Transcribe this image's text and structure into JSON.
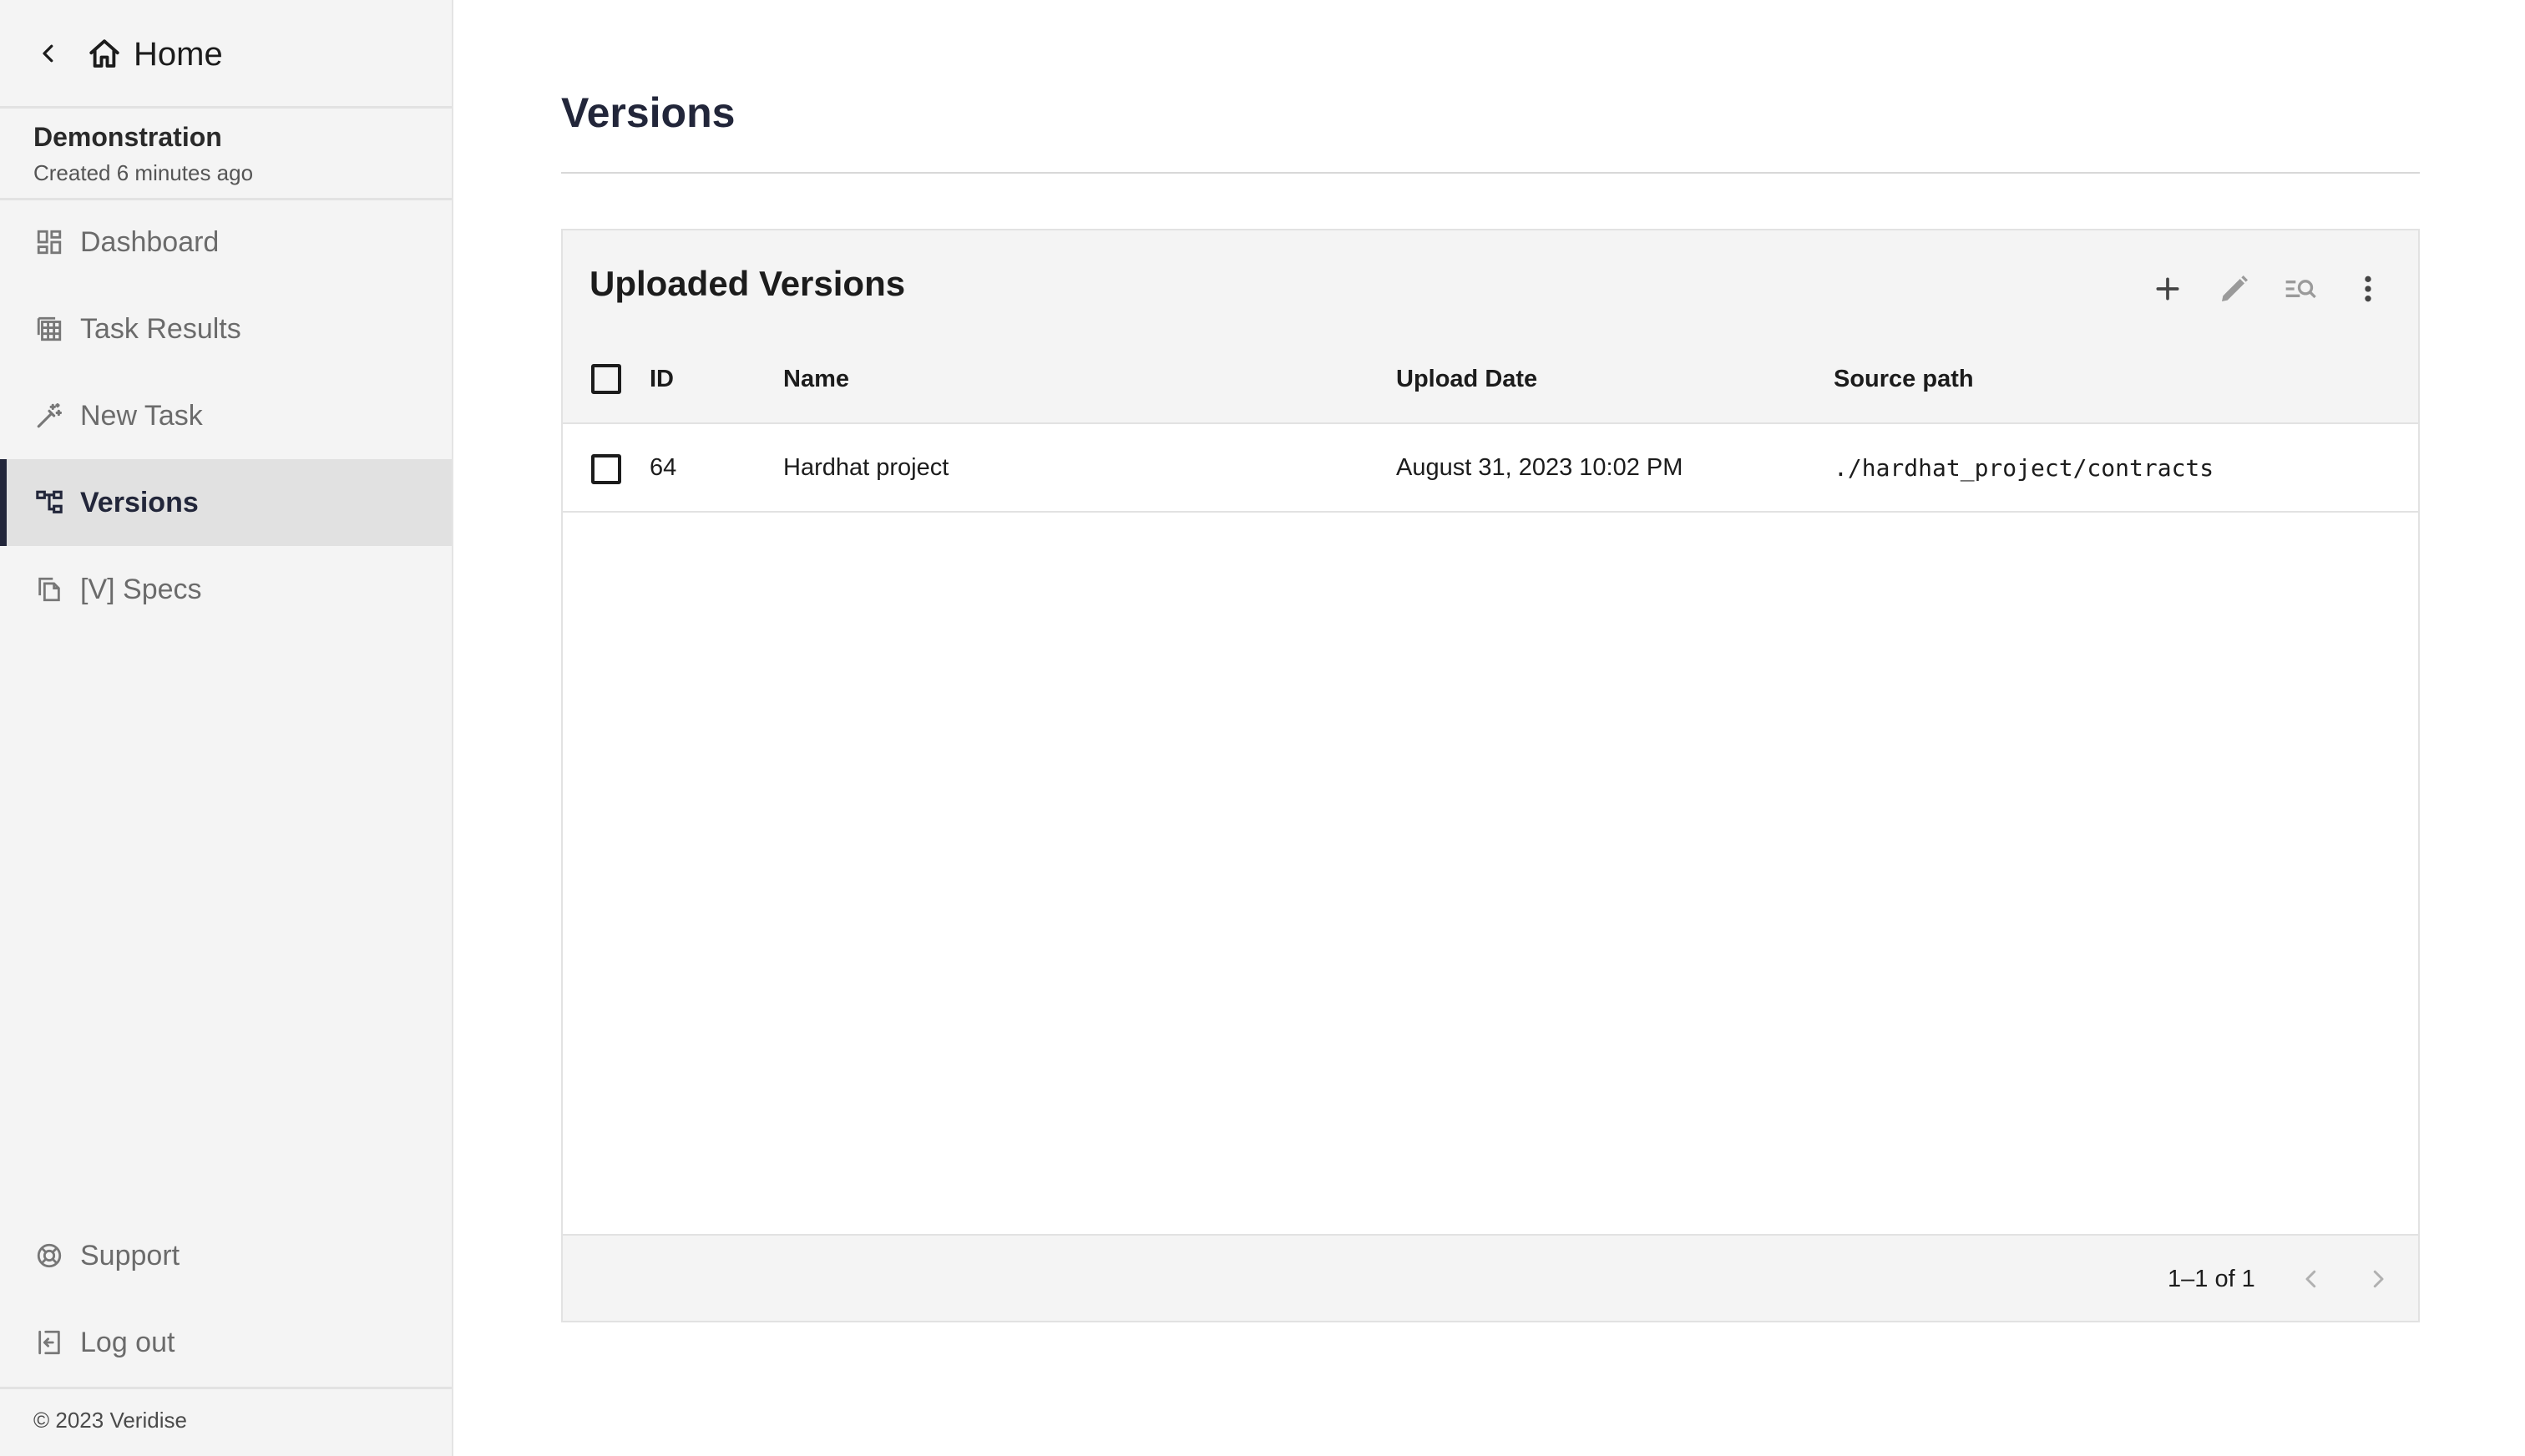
{
  "sidebar": {
    "back_icon": "chevron-left-icon",
    "home_label": "Home",
    "project": {
      "name": "Demonstration",
      "created": "Created 6 minutes ago"
    },
    "items": [
      {
        "label": "Dashboard",
        "icon": "dashboard-icon"
      },
      {
        "label": "Task Results",
        "icon": "table-icon"
      },
      {
        "label": "New Task",
        "icon": "magic-wand-icon"
      },
      {
        "label": "Versions",
        "icon": "account-tree-icon",
        "active": true
      },
      {
        "label": "[V] Specs",
        "icon": "copy-icon"
      }
    ],
    "bottom_items": [
      {
        "label": "Support",
        "icon": "lifebuoy-icon"
      },
      {
        "label": "Log out",
        "icon": "logout-icon"
      }
    ],
    "copyright": "© 2023 Veridise"
  },
  "main": {
    "title": "Versions",
    "card": {
      "title": "Uploaded Versions",
      "toolbar": [
        "add-icon",
        "edit-icon",
        "filter-search-icon",
        "more-vertical-icon"
      ],
      "columns": [
        "ID",
        "Name",
        "Upload Date",
        "Source path"
      ],
      "rows": [
        {
          "id": "64",
          "name": "Hardhat project",
          "upload_date": "August 31, 2023 10:02 PM",
          "source_path": "./hardhat_project/contracts"
        }
      ],
      "pagination": "1–1 of 1"
    }
  },
  "colors": {
    "accent": "#22263a",
    "sidebar_bg": "#f4f4f4",
    "active_bg": "#e1e1e1"
  }
}
